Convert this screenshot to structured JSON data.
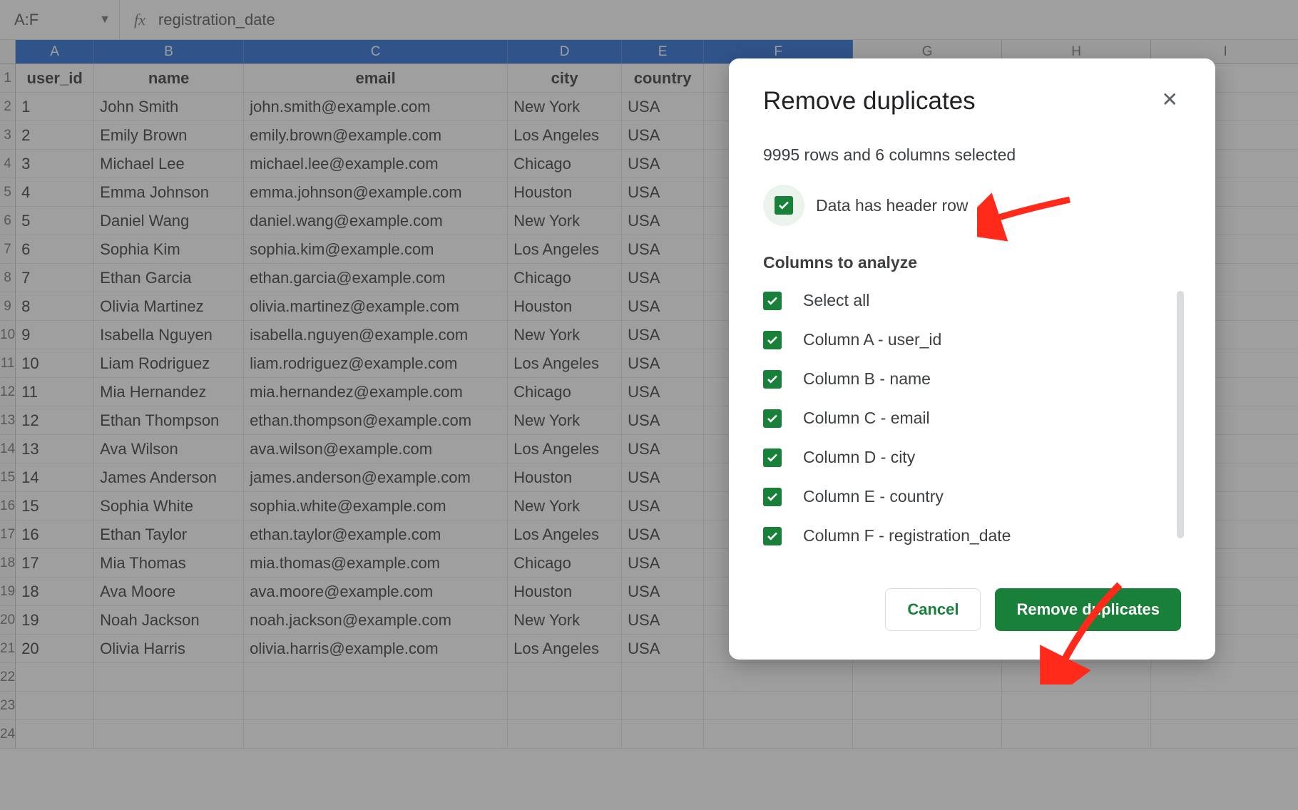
{
  "formula_bar": {
    "name_box": "A:F",
    "fx_label": "fx",
    "formula_value": "registration_date"
  },
  "column_headers_selected": [
    "A",
    "B",
    "C",
    "D",
    "E",
    "F"
  ],
  "column_headers_unselected": [
    "G",
    "H",
    "I"
  ],
  "table": {
    "headers": [
      "user_id",
      "name",
      "email",
      "city",
      "country"
    ],
    "rows": [
      [
        "1",
        "John Smith",
        "john.smith@example.com",
        "New York",
        "USA"
      ],
      [
        "2",
        "Emily Brown",
        "emily.brown@example.com",
        "Los Angeles",
        "USA"
      ],
      [
        "3",
        "Michael Lee",
        "michael.lee@example.com",
        "Chicago",
        "USA"
      ],
      [
        "4",
        "Emma Johnson",
        "emma.johnson@example.com",
        "Houston",
        "USA"
      ],
      [
        "5",
        "Daniel Wang",
        "daniel.wang@example.com",
        "New York",
        "USA"
      ],
      [
        "6",
        "Sophia Kim",
        "sophia.kim@example.com",
        "Los Angeles",
        "USA"
      ],
      [
        "7",
        "Ethan Garcia",
        "ethan.garcia@example.com",
        "Chicago",
        "USA"
      ],
      [
        "8",
        "Olivia Martinez",
        "olivia.martinez@example.com",
        "Houston",
        "USA"
      ],
      [
        "9",
        "Isabella Nguyen",
        "isabella.nguyen@example.com",
        "New York",
        "USA"
      ],
      [
        "10",
        "Liam Rodriguez",
        "liam.rodriguez@example.com",
        "Los Angeles",
        "USA"
      ],
      [
        "11",
        "Mia Hernandez",
        "mia.hernandez@example.com",
        "Chicago",
        "USA"
      ],
      [
        "12",
        "Ethan Thompson",
        "ethan.thompson@example.com",
        "New York",
        "USA"
      ],
      [
        "13",
        "Ava Wilson",
        "ava.wilson@example.com",
        "Los Angeles",
        "USA"
      ],
      [
        "14",
        "James Anderson",
        "james.anderson@example.com",
        "Houston",
        "USA"
      ],
      [
        "15",
        "Sophia White",
        "sophia.white@example.com",
        "New York",
        "USA"
      ],
      [
        "16",
        "Ethan Taylor",
        "ethan.taylor@example.com",
        "Los Angeles",
        "USA"
      ],
      [
        "17",
        "Mia Thomas",
        "mia.thomas@example.com",
        "Chicago",
        "USA"
      ],
      [
        "18",
        "Ava Moore",
        "ava.moore@example.com",
        "Houston",
        "USA"
      ],
      [
        "19",
        "Noah Jackson",
        "noah.jackson@example.com",
        "New York",
        "USA"
      ],
      [
        "20",
        "Olivia Harris",
        "olivia.harris@example.com",
        "Los Angeles",
        "USA"
      ]
    ]
  },
  "dialog": {
    "title": "Remove duplicates",
    "selection_text": "9995 rows and 6 columns selected",
    "header_row_label": "Data has header row",
    "columns_section_title": "Columns to analyze",
    "columns": [
      "Select all",
      "Column A - user_id",
      "Column B - name",
      "Column C - email",
      "Column D - city",
      "Column E - country",
      "Column F - registration_date"
    ],
    "cancel_label": "Cancel",
    "confirm_label": "Remove duplicates"
  },
  "row_number_count": 24
}
